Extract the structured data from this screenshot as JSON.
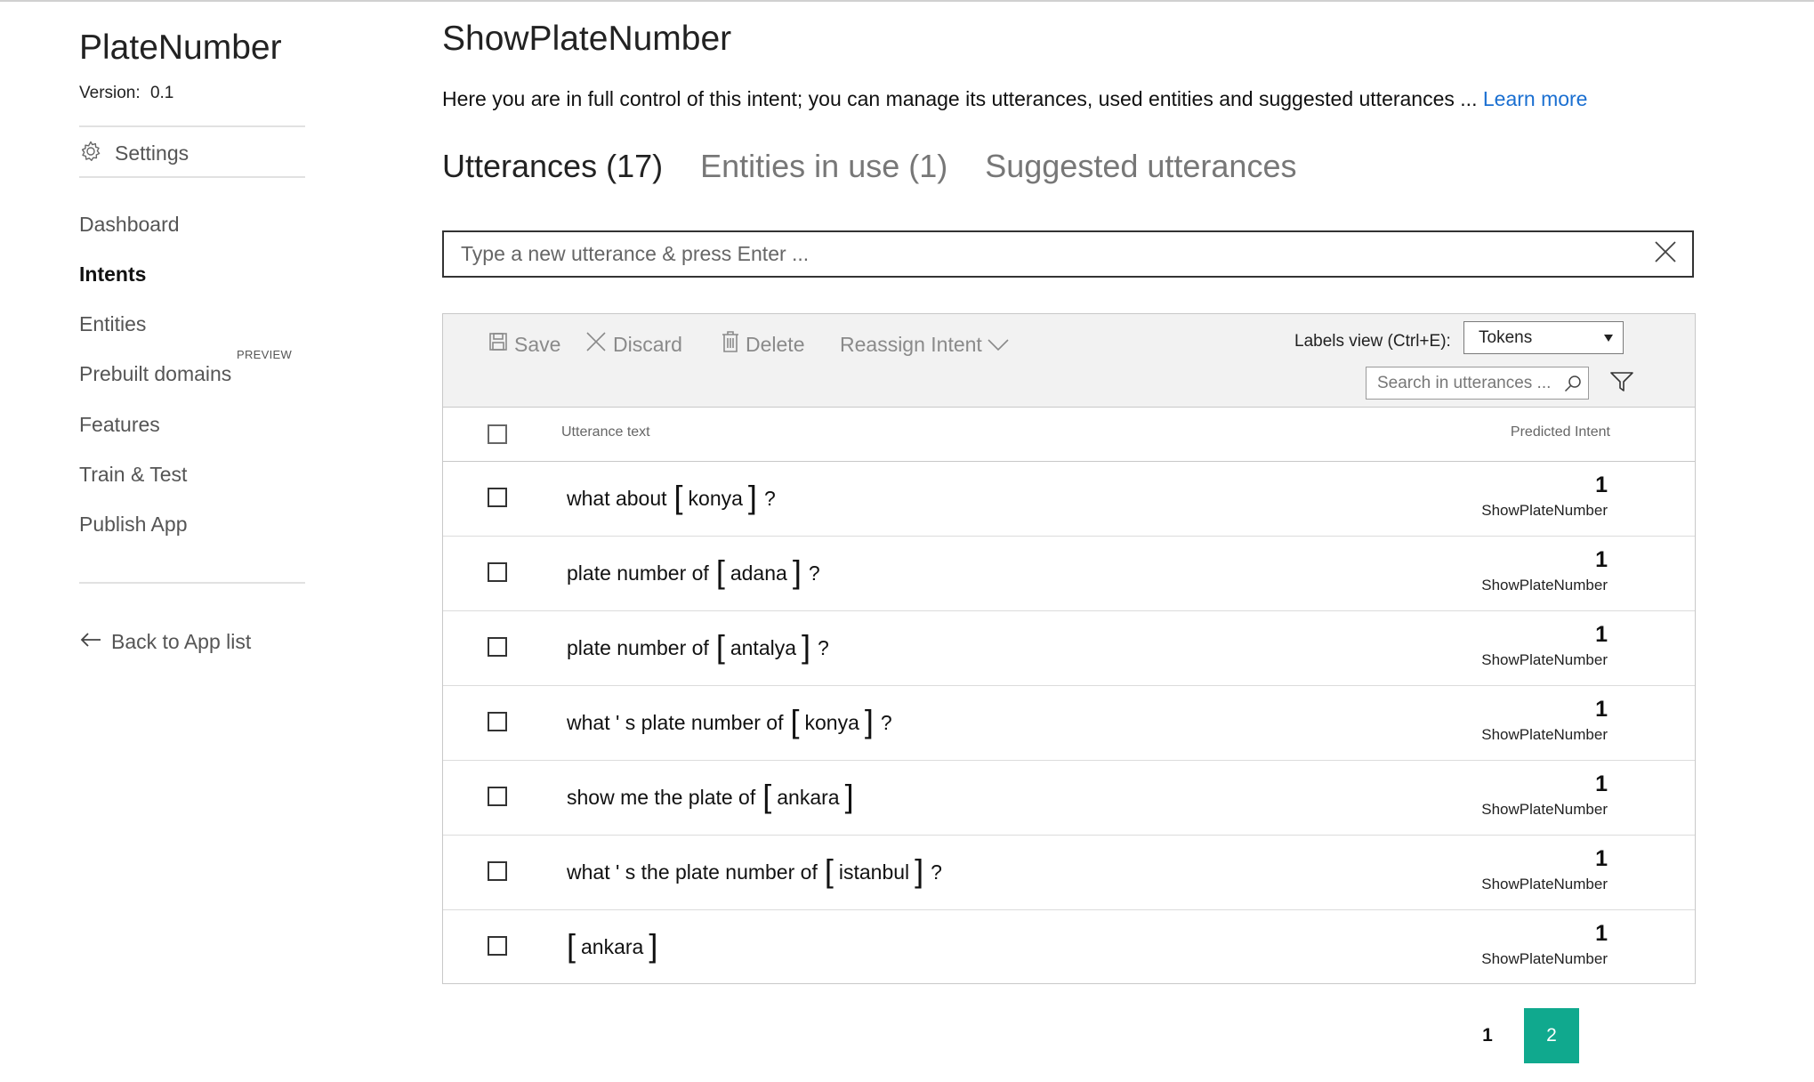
{
  "sidebar": {
    "app_name": "PlateNumber",
    "version_label": "Version:",
    "version_value": "0.1",
    "settings_label": "Settings",
    "nav": [
      {
        "label": "Dashboard",
        "active": false
      },
      {
        "label": "Intents",
        "active": true
      },
      {
        "label": "Entities",
        "active": false
      },
      {
        "label": "Prebuilt domains",
        "active": false,
        "tag": "PREVIEW"
      },
      {
        "label": "Features",
        "active": false
      },
      {
        "label": "Train & Test",
        "active": false
      },
      {
        "label": "Publish App",
        "active": false
      }
    ],
    "back_label": "Back to App list"
  },
  "main": {
    "title": "ShowPlateNumber",
    "description": "Here you are in full control of this intent; you can manage its utterances, used entities and suggested utterances ...",
    "learn_more": "Learn more",
    "tabs": [
      {
        "label": "Utterances (17)",
        "active": true
      },
      {
        "label": "Entities in use (1)",
        "active": false
      },
      {
        "label": "Suggested utterances",
        "active": false
      }
    ],
    "utterance_input_placeholder": "Type a new utterance & press Enter ..."
  },
  "toolbar": {
    "save": "Save",
    "discard": "Discard",
    "delete": "Delete",
    "reassign": "Reassign Intent",
    "labels_view_label": "Labels view (Ctrl+E):",
    "labels_view_value": "Tokens",
    "search_placeholder": "Search in utterances ..."
  },
  "table": {
    "col_text": "Utterance text",
    "col_predicted": "Predicted Intent",
    "rows": [
      {
        "before": "what about",
        "entity": "konya",
        "after": "?",
        "score": "1",
        "intent": "ShowPlateNumber"
      },
      {
        "before": "plate number of",
        "entity": "adana",
        "after": "?",
        "score": "1",
        "intent": "ShowPlateNumber"
      },
      {
        "before": "plate number of",
        "entity": "antalya",
        "after": "?",
        "score": "1",
        "intent": "ShowPlateNumber"
      },
      {
        "before": "what ' s plate number of",
        "entity": "konya",
        "after": "?",
        "score": "1",
        "intent": "ShowPlateNumber"
      },
      {
        "before": "show me the plate of",
        "entity": "ankara",
        "after": "",
        "score": "1",
        "intent": "ShowPlateNumber"
      },
      {
        "before": "what ' s the plate number of",
        "entity": "istanbul",
        "after": "?",
        "score": "1",
        "intent": "ShowPlateNumber"
      },
      {
        "before": "",
        "entity": "ankara",
        "after": "",
        "score": "1",
        "intent": "ShowPlateNumber"
      }
    ]
  },
  "pagination": {
    "pages": [
      "1",
      "2"
    ],
    "current": "2"
  },
  "colors": {
    "accent": "#10a98e",
    "link": "#1a6fd1",
    "toolbar_bg": "#f2f2f2"
  }
}
